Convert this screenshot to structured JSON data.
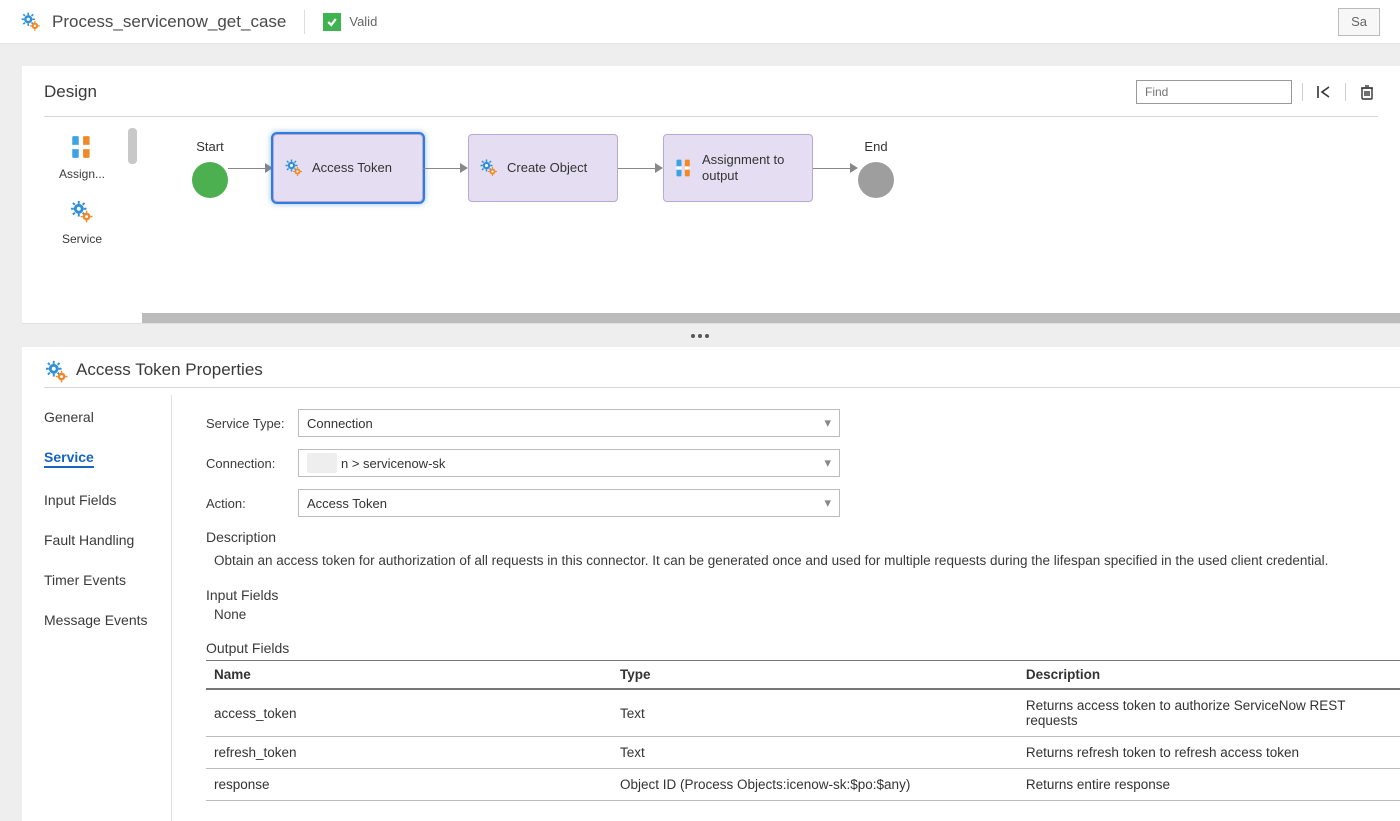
{
  "titlebar": {
    "doc_title": "Process_servicenow_get_case",
    "valid_label": "Valid",
    "save_label": "Sa"
  },
  "design": {
    "title": "Design",
    "find_placeholder": "Find",
    "palette": [
      {
        "label": "Assign..."
      },
      {
        "label": "Service"
      }
    ],
    "flow": {
      "start_label": "Start",
      "end_label": "End",
      "tasks": [
        {
          "label": "Access Token",
          "selected": true,
          "kind": "service"
        },
        {
          "label": "Create Object",
          "selected": false,
          "kind": "service"
        },
        {
          "label": "Assignment to output",
          "selected": false,
          "kind": "assign"
        }
      ]
    }
  },
  "properties": {
    "title": "Access Token Properties",
    "tabs": [
      {
        "label": "General",
        "active": false
      },
      {
        "label": "Service",
        "active": true
      },
      {
        "label": "Input Fields",
        "active": false
      },
      {
        "label": "Fault Handling",
        "active": false
      },
      {
        "label": "Timer Events",
        "active": false
      },
      {
        "label": "Message Events",
        "active": false
      }
    ],
    "form": {
      "service_type_label": "Service Type:",
      "service_type_value": "Connection",
      "connection_label": "Connection:",
      "connection_value": "n > servicenow-sk",
      "action_label": "Action:",
      "action_value": "Access Token",
      "description_label": "Description",
      "description_text": "Obtain an access token for authorization of all requests in this connector. It can be generated once and used for multiple requests during the lifespan specified in the used client credential.",
      "input_fields_label": "Input Fields",
      "input_fields_none": "None",
      "output_fields_label": "Output Fields",
      "columns": {
        "name": "Name",
        "type": "Type",
        "description": "Description"
      },
      "rows": [
        {
          "name": "access_token",
          "type": "Text",
          "description": "Returns access token to authorize ServiceNow REST requests"
        },
        {
          "name": "refresh_token",
          "type": "Text",
          "description": "Returns refresh token to refresh access token"
        },
        {
          "name": "response",
          "type": "Object ID (Process Objects:icenow-sk:$po:$any)",
          "description": "Returns entire response"
        }
      ]
    }
  }
}
